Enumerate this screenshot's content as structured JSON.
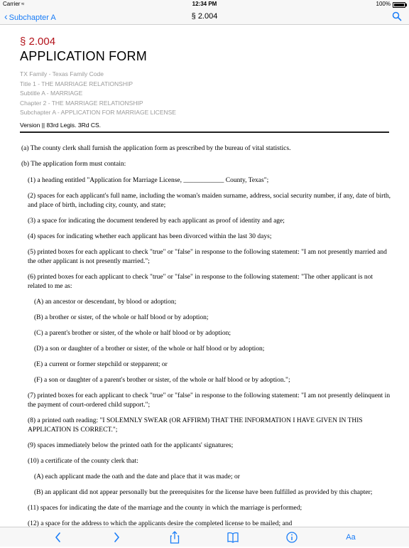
{
  "status_bar": {
    "carrier": "Carrier",
    "time": "12:34 PM",
    "battery": "100%"
  },
  "nav": {
    "back_label": "Subchapter A",
    "title": "§ 2.004"
  },
  "header": {
    "section_number": "§ 2.004",
    "section_title": "APPLICATION FORM",
    "breadcrumbs": [
      "TX Family - Texas Family Code",
      "Title 1 - THE MARRIAGE RELATIONSHIP",
      "Subtitle A - MARRIAGE",
      "Chapter 2 - THE MARRIAGE RELATIONSHIP",
      "Subchapter A - APPLICATION FOR MARRIAGE LICENSE"
    ],
    "version": "Version || 83rd Legis. 3Rd CS."
  },
  "paragraphs": [
    "(a) The county clerk shall furnish the application form as prescribed by the bureau of vital statistics.",
    "(b) The application form must contain:",
    "(1) a heading entitled \"Application for Marriage License, ____________ County, Texas\";",
    "(2) spaces for each applicant's full name, including the woman's maiden surname, address, social security number, if any, date of birth, and place of birth, including city, county, and state;",
    "(3) a space for indicating the document tendered by each applicant as proof of identity and age;",
    "(4) spaces for indicating whether each applicant has been divorced within the last 30 days;",
    "(5) printed boxes for each applicant to check \"true\" or \"false\" in response to the following statement: \"I am not presently married and the other applicant is not presently married.\";",
    "(6) printed boxes for each applicant to check \"true\" or \"false\" in response to the following statement: \"The other applicant is not related to me as:",
    "(A) an ancestor or descendant, by blood or adoption;",
    "(B) a brother or sister, of the whole or half blood or by adoption;",
    "(C) a parent's brother or sister, of the whole or half blood or by adoption;",
    "(D) a son or daughter of a brother or sister, of the whole or half blood or by adoption;",
    "(E) a current or former stepchild or stepparent; or",
    "(F) a son or daughter of a parent's brother or sister, of the whole or half blood or by adoption.\";",
    "(7) printed boxes for each applicant to check \"true\" or \"false\" in response to the following statement: \"I am not presently delinquent in the payment of court-ordered child support.\";",
    "(8) a printed oath reading: \"I SOLEMNLY SWEAR (OR AFFIRM) THAT THE INFORMATION I HAVE GIVEN IN THIS APPLICATION IS CORRECT.\";",
    "(9) spaces immediately below the printed oath for the applicants' signatures;",
    "(10) a certificate of the county clerk that:",
    "(A) each applicant made the oath and the date and place that it was made; or",
    "(B) an applicant did not appear personally but the prerequisites for the license have been fulfilled as provided by this chapter;",
    "(11) spaces for indicating the date of the marriage and the county in which the marriage is performed;",
    "(12) a space for the address to which the applicants desire the completed license to be mailed; and"
  ],
  "toolbar": {
    "text_size_label": "Aa"
  },
  "colors": {
    "accent": "#1a7df7",
    "section_number": "#b3121a",
    "breadcrumb": "#9a9a9a"
  }
}
